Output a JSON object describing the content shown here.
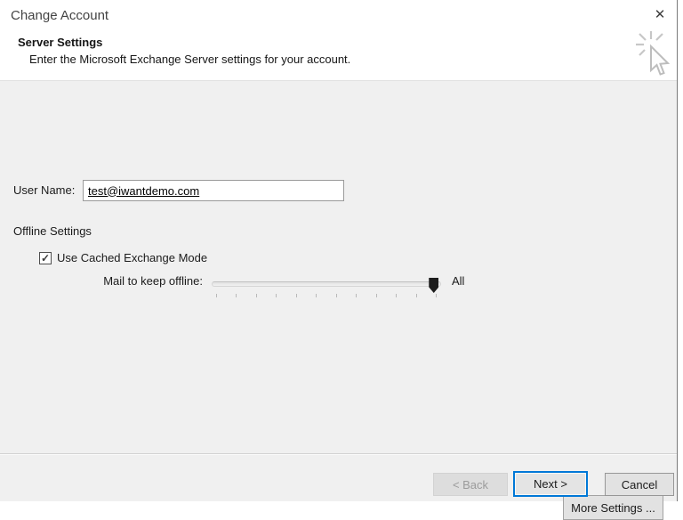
{
  "window": {
    "title": "Change Account"
  },
  "icons": {
    "close": "✕",
    "check": "✓",
    "wizard": "click-cursor-starburst"
  },
  "header": {
    "title": "Server Settings",
    "subtitle": "Enter the Microsoft Exchange Server settings for your account."
  },
  "form": {
    "user_name": {
      "label": "User Name:",
      "value": "test@iwantdemo.com"
    },
    "offline_settings_label": "Offline Settings",
    "cached_mode": {
      "label": "Use Cached Exchange Mode",
      "checked": true
    },
    "slider": {
      "label": "Mail to keep offline:",
      "value_label": "All",
      "tick_count": 12,
      "position_pct": 97
    }
  },
  "buttons": {
    "more_settings": "More Settings ...",
    "back": "< Back",
    "next": "Next >",
    "cancel": "Cancel"
  },
  "colors": {
    "accent": "#0078d7",
    "dialog_bg": "#f0f0f0",
    "header_bg": "#ffffff",
    "thumb": "#1d1d1d"
  }
}
